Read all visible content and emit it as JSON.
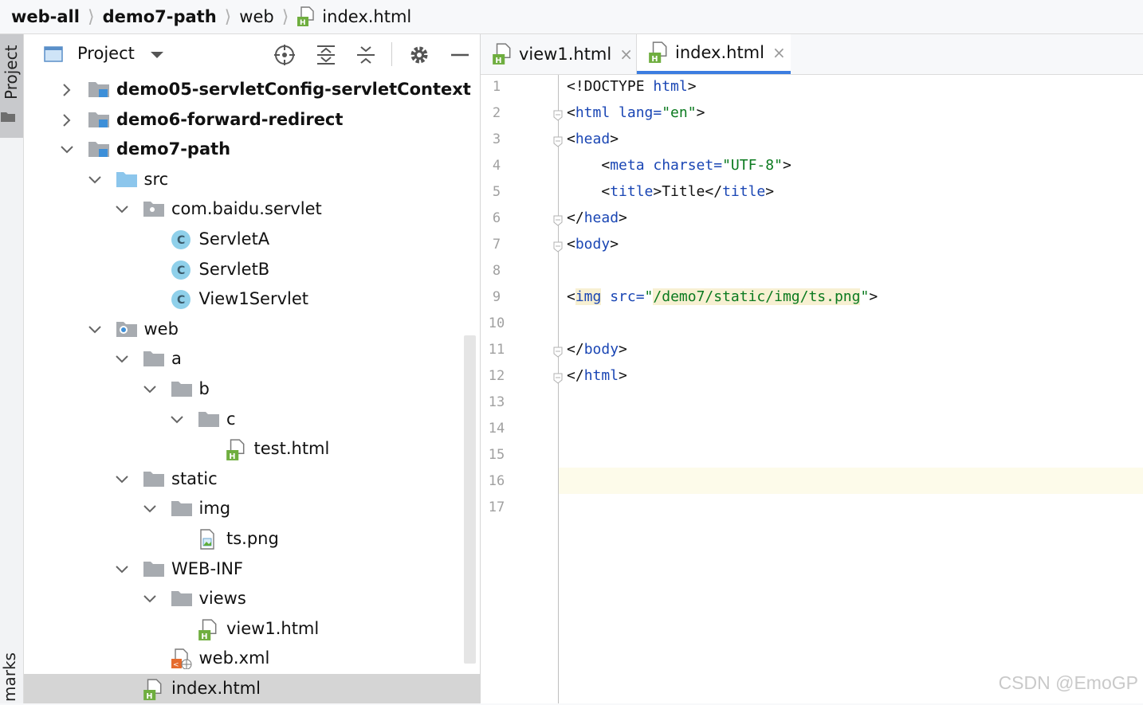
{
  "breadcrumb": [
    {
      "label": "web-all",
      "bold": true
    },
    {
      "label": "demo7-path",
      "bold": true
    },
    {
      "label": "web",
      "bold": false
    },
    {
      "label": "index.html",
      "bold": false
    }
  ],
  "left_stripe": {
    "project_label": "Project",
    "bookmarks_label": "marks"
  },
  "project_panel": {
    "title": "Project",
    "toolbar_icons": [
      "crosshair-icon",
      "expand-all-icon",
      "collapse-all-icon",
      "gear-icon",
      "minimize-icon"
    ]
  },
  "tree": [
    {
      "label": "demo05-servletConfig-servletContext",
      "icon": "module-folder-icon",
      "state": "collapsed",
      "bold": true
    },
    {
      "label": "demo6-forward-redirect",
      "icon": "module-folder-icon",
      "state": "collapsed",
      "bold": true
    },
    {
      "label": "demo7-path",
      "icon": "module-folder-icon",
      "state": "expanded",
      "bold": true
    },
    {
      "label": "src",
      "icon": "source-folder-icon",
      "state": "expanded",
      "bold": false
    },
    {
      "label": "com.baidu.servlet",
      "icon": "package-icon",
      "state": "expanded",
      "bold": false
    },
    {
      "label": "ServletA",
      "icon": "class-icon",
      "state": "leaf",
      "bold": false
    },
    {
      "label": "ServletB",
      "icon": "class-icon",
      "state": "leaf",
      "bold": false
    },
    {
      "label": "View1Servlet",
      "icon": "class-icon",
      "state": "leaf",
      "bold": false
    },
    {
      "label": "web",
      "icon": "web-folder-icon",
      "state": "expanded",
      "bold": false
    },
    {
      "label": "a",
      "icon": "folder-icon",
      "state": "expanded",
      "bold": false
    },
    {
      "label": "b",
      "icon": "folder-icon",
      "state": "expanded",
      "bold": false
    },
    {
      "label": "c",
      "icon": "folder-icon",
      "state": "expanded",
      "bold": false
    },
    {
      "label": "test.html",
      "icon": "html-file-icon",
      "state": "leaf",
      "bold": false
    },
    {
      "label": "static",
      "icon": "folder-icon",
      "state": "expanded",
      "bold": false
    },
    {
      "label": "img",
      "icon": "folder-icon",
      "state": "expanded",
      "bold": false
    },
    {
      "label": "ts.png",
      "icon": "image-file-icon",
      "state": "leaf",
      "bold": false
    },
    {
      "label": "WEB-INF",
      "icon": "folder-icon",
      "state": "expanded",
      "bold": false
    },
    {
      "label": "views",
      "icon": "folder-icon",
      "state": "expanded",
      "bold": false
    },
    {
      "label": "view1.html",
      "icon": "html-file-icon",
      "state": "leaf",
      "bold": false
    },
    {
      "label": "web.xml",
      "icon": "xml-file-icon",
      "state": "leaf",
      "bold": false
    },
    {
      "label": "index.html",
      "icon": "html-file-icon",
      "state": "leaf",
      "bold": false,
      "selected": true
    }
  ],
  "tabs": [
    {
      "label": "view1.html",
      "icon": "html-file-icon",
      "active": false,
      "close": "×"
    },
    {
      "label": "index.html",
      "icon": "html-file-icon",
      "active": true,
      "close": "×"
    }
  ],
  "code_lines": [
    [
      {
        "t": "<!DOCTYPE ",
        "c": ""
      },
      {
        "t": "html",
        "c": "tag"
      },
      {
        "t": ">",
        "c": ""
      }
    ],
    [
      {
        "t": "<",
        "c": ""
      },
      {
        "t": "html ",
        "c": "tag"
      },
      {
        "t": "lang=",
        "c": "tag"
      },
      {
        "t": "\"en\"",
        "c": "str"
      },
      {
        "t": ">",
        "c": ""
      }
    ],
    [
      {
        "t": "<",
        "c": ""
      },
      {
        "t": "head",
        "c": "tag"
      },
      {
        "t": ">",
        "c": ""
      }
    ],
    [
      {
        "t": "    <",
        "c": ""
      },
      {
        "t": "meta ",
        "c": "tag"
      },
      {
        "t": "charset=",
        "c": "tag"
      },
      {
        "t": "\"UTF-8\"",
        "c": "str"
      },
      {
        "t": ">",
        "c": ""
      }
    ],
    [
      {
        "t": "    <",
        "c": ""
      },
      {
        "t": "title",
        "c": "tag"
      },
      {
        "t": ">Title</",
        "c": ""
      },
      {
        "t": "title",
        "c": "tag"
      },
      {
        "t": ">",
        "c": ""
      }
    ],
    [
      {
        "t": "</",
        "c": ""
      },
      {
        "t": "head",
        "c": "tag"
      },
      {
        "t": ">",
        "c": ""
      }
    ],
    [
      {
        "t": "<",
        "c": ""
      },
      {
        "t": "body",
        "c": "tag"
      },
      {
        "t": ">",
        "c": ""
      }
    ],
    [],
    [
      {
        "t": "<",
        "c": ""
      },
      {
        "t": "img",
        "c": "tag hl"
      },
      {
        "t": " src=",
        "c": "tag"
      },
      {
        "t": "\"",
        "c": "str"
      },
      {
        "t": "/demo7/static/img/ts.png",
        "c": "str hl"
      },
      {
        "t": "\"",
        "c": "str"
      },
      {
        "t": ">",
        "c": ""
      }
    ],
    [],
    [
      {
        "t": "</",
        "c": ""
      },
      {
        "t": "body",
        "c": "tag"
      },
      {
        "t": ">",
        "c": ""
      }
    ],
    [
      {
        "t": "</",
        "c": ""
      },
      {
        "t": "html",
        "c": "tag"
      },
      {
        "t": ">",
        "c": ""
      }
    ],
    [],
    [],
    [],
    [],
    []
  ],
  "line_numbers": [
    "1",
    "2",
    "3",
    "4",
    "5",
    "6",
    "7",
    "8",
    "9",
    "10",
    "11",
    "12",
    "13",
    "14",
    "15",
    "16",
    "17"
  ],
  "fold_markers": [
    2,
    3,
    6,
    7,
    11,
    12
  ],
  "current_line": 16,
  "watermark": "CSDN @EmoGP",
  "colors": {
    "tag": "#1a46b4",
    "string": "#0b7a1f",
    "accent": "#3c7de0",
    "current_line": "#fdfbea",
    "highlight": "#f7f0d2"
  }
}
